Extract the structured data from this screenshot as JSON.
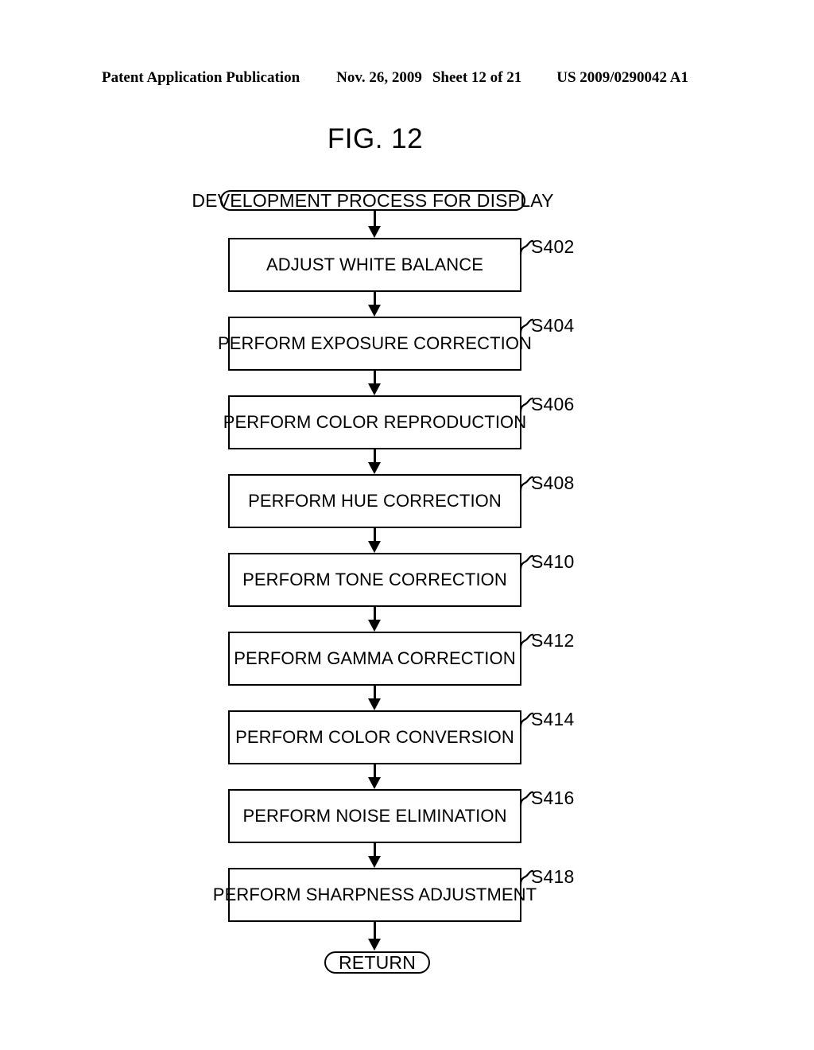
{
  "header": {
    "publication": "Patent Application Publication",
    "date": "Nov. 26, 2009",
    "sheet": "Sheet 12 of 21",
    "patent_number": "US 2009/0290042 A1"
  },
  "figure": {
    "title": "FIG. 12"
  },
  "chart_data": {
    "type": "diagram",
    "diagram_type": "flowchart",
    "orientation": "vertical",
    "title": "FIG. 12",
    "start_terminator": "DEVELOPMENT PROCESS FOR DISPLAY",
    "end_terminator": "RETURN",
    "steps": [
      {
        "label": "ADJUST WHITE BALANCE",
        "step": "S402"
      },
      {
        "label": "PERFORM EXPOSURE CORRECTION",
        "step": "S404"
      },
      {
        "label": "PERFORM COLOR REPRODUCTION",
        "step": "S406"
      },
      {
        "label": "PERFORM HUE CORRECTION",
        "step": "S408"
      },
      {
        "label": "PERFORM TONE CORRECTION",
        "step": "S410"
      },
      {
        "label": "PERFORM GAMMA CORRECTION",
        "step": "S412"
      },
      {
        "label": "PERFORM COLOR CONVERSION",
        "step": "S414"
      },
      {
        "label": "PERFORM NOISE ELIMINATION",
        "step": "S416"
      },
      {
        "label": "PERFORM SHARPNESS ADJUSTMENT",
        "step": "S418"
      }
    ],
    "edges": [
      {
        "from": "DEVELOPMENT PROCESS FOR DISPLAY",
        "to": "ADJUST WHITE BALANCE"
      },
      {
        "from": "ADJUST WHITE BALANCE",
        "to": "PERFORM EXPOSURE CORRECTION"
      },
      {
        "from": "PERFORM EXPOSURE CORRECTION",
        "to": "PERFORM COLOR REPRODUCTION"
      },
      {
        "from": "PERFORM COLOR REPRODUCTION",
        "to": "PERFORM HUE CORRECTION"
      },
      {
        "from": "PERFORM HUE CORRECTION",
        "to": "PERFORM TONE CORRECTION"
      },
      {
        "from": "PERFORM TONE CORRECTION",
        "to": "PERFORM GAMMA CORRECTION"
      },
      {
        "from": "PERFORM GAMMA CORRECTION",
        "to": "PERFORM COLOR CONVERSION"
      },
      {
        "from": "PERFORM COLOR CONVERSION",
        "to": "PERFORM NOISE ELIMINATION"
      },
      {
        "from": "PERFORM NOISE ELIMINATION",
        "to": "PERFORM SHARPNESS ADJUSTMENT"
      },
      {
        "from": "PERFORM SHARPNESS ADJUSTMENT",
        "to": "RETURN"
      }
    ],
    "colors": {
      "stroke": "#000000",
      "fill": "#ffffff"
    }
  }
}
